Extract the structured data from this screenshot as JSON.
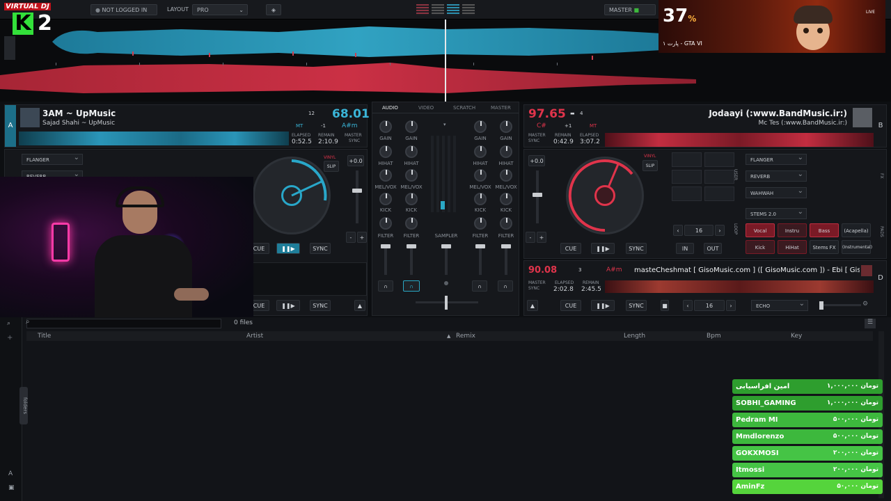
{
  "top": {
    "login": "NOT LOGGED IN",
    "layout_label": "LAYOUT",
    "layout_value": "PRO",
    "master_label": "MASTER"
  },
  "logo": {
    "text": "VIRTUAL DJ",
    "k": "K",
    "two": "2"
  },
  "stream": {
    "percent": "37",
    "pct_sign": "%",
    "subtitle": "پارت ۱ - GTA VI",
    "live": "LIVE"
  },
  "deckA": {
    "letter": "A",
    "title": "3AM ~ UpMusic",
    "artist": "Sajad Shahi  ~ UpMusic",
    "pitch_num": "12",
    "bpm": "68.01",
    "mt": "MT",
    "pitch_adj": "-1",
    "key": "A#m",
    "elapsed_label": "ELAPSED",
    "remain_label": "REMAIN",
    "master_label": "MASTER",
    "elapsed": "0:52.5",
    "remain": "2:10.9",
    "sync_label": "SYNC",
    "fx": [
      "FLANGER",
      "REVERB"
    ],
    "vinyl": "VINYL",
    "slip": "SLIP",
    "pitch_val": "+0.0",
    "cue": "CUE",
    "sync": "SYNC"
  },
  "deckC": {
    "cue": "CUE",
    "sync": "SYNC"
  },
  "deckB": {
    "letter": "B",
    "title": "Jodaayi (:www.BandMusic.ir:)",
    "artist": "Mc Tes (:www.BandMusic.ir:)",
    "bpm": "97.65",
    "key": "C#",
    "pitch_num": "4",
    "pitch_adj": "+1",
    "mt": "MT",
    "master_label": "MASTER",
    "sync_label": "SYNC",
    "remain_label": "REMAIN",
    "elapsed_label": "ELAPSED",
    "remain": "0:42.9",
    "elapsed": "3:07.2",
    "vinyl": "VINYL",
    "slip": "SLIP",
    "pitch_val": "+0.0",
    "cue": "CUE",
    "sync": "SYNC",
    "fx": [
      "FLANGER",
      "REVERB",
      "WAHWAH"
    ],
    "user": "USER",
    "fx_side": "FX",
    "loop": "LOOP",
    "pads": "PADS",
    "stems": "STEMS 2.0",
    "loop_val": "16",
    "in": "IN",
    "out": "OUT",
    "stem_pads": [
      "Vocal",
      "Instru",
      "Bass",
      "(Acapella)",
      "Kick",
      "HiHat",
      "Stems FX",
      "(Instrumental)"
    ]
  },
  "deckD": {
    "letter": "D",
    "bpm": "90.08",
    "pitch_num": "3",
    "key": "A#m",
    "title": "masteCheshmat [ GisoMusic.com ] ([ GisoMusic.com ]) - Ebi [ Gisc",
    "master_label": "MASTER",
    "sync_label": "SYNC",
    "elapsed_label": "ELAPSED",
    "remain_label": "REMAIN",
    "elapsed": "2:02.8",
    "remain": "2:45.5",
    "cue": "CUE",
    "sync": "SYNC",
    "loop_val": "16",
    "fx": "ECHO"
  },
  "mixer": {
    "tabs": [
      "AUDIO",
      "VIDEO",
      "SCRATCH",
      "MASTER"
    ],
    "knobs": [
      "GAIN",
      "HIHAT",
      "MEL/VOX",
      "KICK",
      "FILTER"
    ],
    "sampler": "SAMPLER"
  },
  "browser": {
    "files": "0 files",
    "columns": [
      "Title",
      "Artist",
      "Remix",
      "Length",
      "Bpm",
      "Key"
    ],
    "folders": "folders"
  },
  "donations": [
    {
      "name": "امین افراسیابی",
      "amount": "۱,۰۰۰,۰۰۰ تومان",
      "color": "#2e9e2e"
    },
    {
      "name": "SOBHI_GAMING",
      "amount": "۱,۰۰۰,۰۰۰ تومان",
      "color": "#2e9e2e"
    },
    {
      "name": "Pedram MI",
      "amount": "۵۰۰,۰۰۰ تومان",
      "color": "#3db83d"
    },
    {
      "name": "Mmdlorenzo",
      "amount": "۵۰۰,۰۰۰ تومان",
      "color": "#3db83d"
    },
    {
      "name": "GOKXMOSI",
      "amount": "۲۰۰,۰۰۰ تومان",
      "color": "#45c445"
    },
    {
      "name": "Itmossi",
      "amount": "۲۰۰,۰۰۰ تومان",
      "color": "#45c445"
    },
    {
      "name": "AminFz",
      "amount": "۵۰,۰۰۰ تومان",
      "color": "#55d43c"
    }
  ],
  "colors": {
    "deckA": "#29a7c9",
    "deckB": "#e0344b",
    "donation": "#3db83d"
  }
}
